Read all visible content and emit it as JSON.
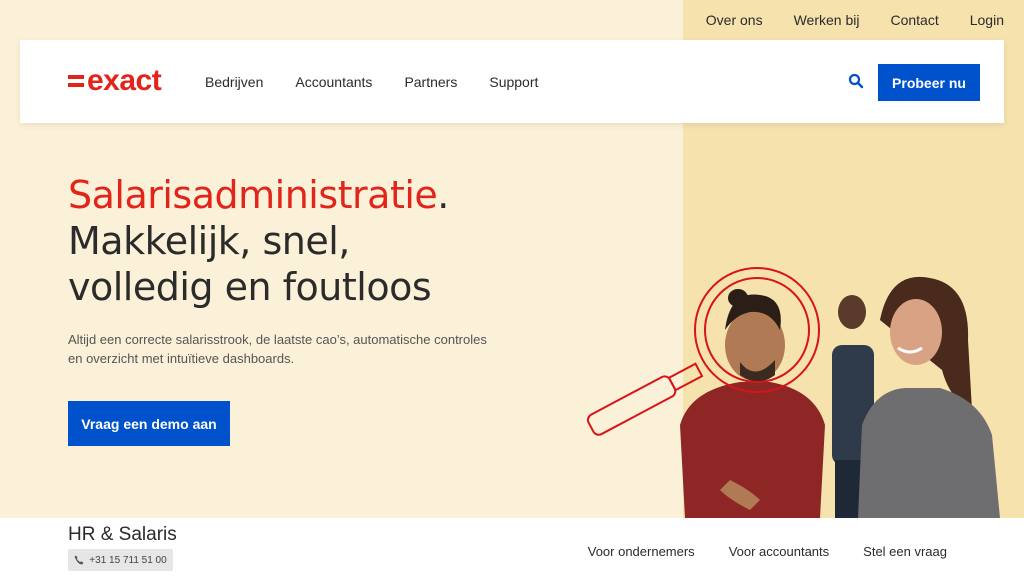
{
  "utility_nav": [
    "Over ons",
    "Werken bij",
    "Contact",
    "Login"
  ],
  "brand": {
    "logo_text": "exact",
    "accent": "#e1251b",
    "primary": "#0052cc"
  },
  "main_nav": {
    "items": [
      "Bedrijven",
      "Accountants",
      "Partners",
      "Support"
    ],
    "search_icon": "search-icon",
    "cta_label": "Probeer nu"
  },
  "hero": {
    "title_red": "Salarisadministratie",
    "title_dot": ".",
    "title_line2": "Makkelijk, snel,",
    "title_line3": "volledig en foutloos",
    "subtitle": "Altijd een correcte salarisstrook, de laatste cao’s, automatische controles en overzicht met intuïtieve dashboards.",
    "cta_label": "Vraag een demo aan"
  },
  "bottom_bar": {
    "title": "HR & Salaris",
    "phone": "+31 15 711 51 00",
    "links": [
      "Voor ondernemers",
      "Voor accountants",
      "Stel een vraag"
    ]
  }
}
